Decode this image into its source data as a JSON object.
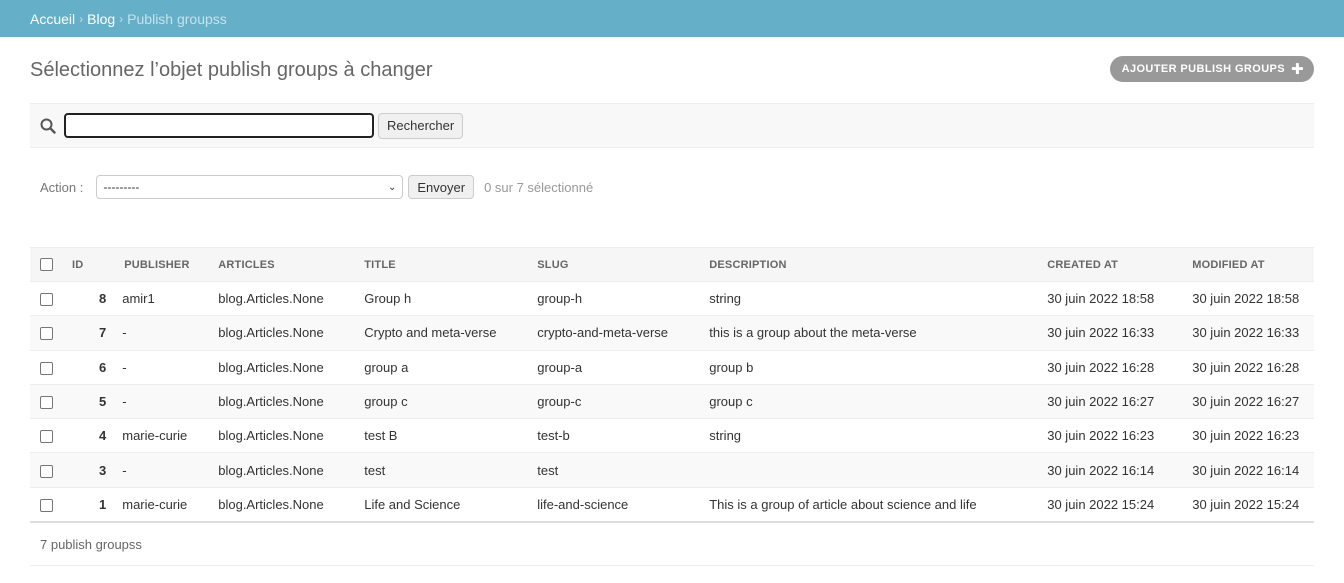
{
  "breadcrumbs": {
    "home": "Accueil",
    "app": "Blog",
    "current": "Publish groupss",
    "separator": "›"
  },
  "page": {
    "title": "Sélectionnez l’objet publish groups à changer",
    "add_label": "AJOUTER PUBLISH GROUPS"
  },
  "search": {
    "value": "",
    "button_label": "Rechercher"
  },
  "actions": {
    "label": "Action :",
    "selected_option": "---------",
    "go_label": "Envoyer",
    "selection_counter": "0 sur 7 sélectionné"
  },
  "table": {
    "columns": [
      "ID",
      "PUBLISHER",
      "ARTICLES",
      "TITLE",
      "SLUG",
      "DESCRIPTION",
      "CREATED AT",
      "MODIFIED AT"
    ],
    "rows": [
      {
        "id": "8",
        "publisher": "amir1",
        "articles": "blog.Articles.None",
        "title": "Group h",
        "slug": "group-h",
        "description": "string",
        "created": "30 juin 2022 18:58",
        "modified": "30 juin 2022 18:58"
      },
      {
        "id": "7",
        "publisher": "-",
        "articles": "blog.Articles.None",
        "title": "Crypto and meta-verse",
        "slug": "crypto-and-meta-verse",
        "description": "this is a group about the meta-verse",
        "created": "30 juin 2022 16:33",
        "modified": "30 juin 2022 16:33"
      },
      {
        "id": "6",
        "publisher": "-",
        "articles": "blog.Articles.None",
        "title": "group a",
        "slug": "group-a",
        "description": "group b",
        "created": "30 juin 2022 16:28",
        "modified": "30 juin 2022 16:28"
      },
      {
        "id": "5",
        "publisher": "-",
        "articles": "blog.Articles.None",
        "title": "group c",
        "slug": "group-c",
        "description": "group c",
        "created": "30 juin 2022 16:27",
        "modified": "30 juin 2022 16:27"
      },
      {
        "id": "4",
        "publisher": "marie-curie",
        "articles": "blog.Articles.None",
        "title": "test B",
        "slug": "test-b",
        "description": "string",
        "created": "30 juin 2022 16:23",
        "modified": "30 juin 2022 16:23"
      },
      {
        "id": "3",
        "publisher": "-",
        "articles": "blog.Articles.None",
        "title": "test",
        "slug": "test",
        "description": "",
        "created": "30 juin 2022 16:14",
        "modified": "30 juin 2022 16:14"
      },
      {
        "id": "1",
        "publisher": "marie-curie",
        "articles": "blog.Articles.None",
        "title": "Life and Science",
        "slug": "life-and-science",
        "description": "This is a group of article about science and life",
        "created": "30 juin 2022 15:24",
        "modified": "30 juin 2022 15:24"
      }
    ]
  },
  "paginator": {
    "text": "7 publish groupss"
  },
  "icons": {
    "search": "search-icon",
    "add": "plus-icon",
    "dropdown": "chevron-down-icon"
  },
  "colors": {
    "header": "#65b0c8",
    "link": "#447e9b",
    "add_button": "#999999"
  }
}
